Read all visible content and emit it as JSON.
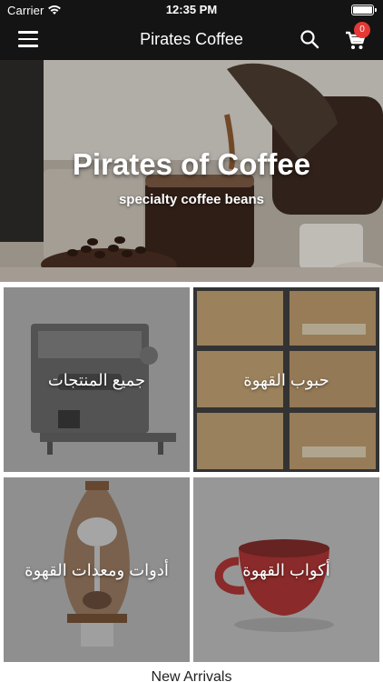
{
  "status_bar": {
    "carrier": "Carrier",
    "time": "12:35 PM"
  },
  "nav": {
    "title": "Pirates Coffee",
    "cart_count": "0"
  },
  "hero": {
    "title": "Pirates of Coffee",
    "subtitle": "specialty coffee beans"
  },
  "categories": [
    {
      "label": "جميع المنتجات"
    },
    {
      "label": "حبوب القهوة"
    },
    {
      "label": "أدوات ومعدات القهوة"
    },
    {
      "label": "أكواب القهوة"
    }
  ],
  "new_arrivals": {
    "title": "New Arrivals"
  },
  "icons": [
    "menu-icon",
    "wifi-icon",
    "battery-icon",
    "search-icon",
    "cart-icon"
  ]
}
